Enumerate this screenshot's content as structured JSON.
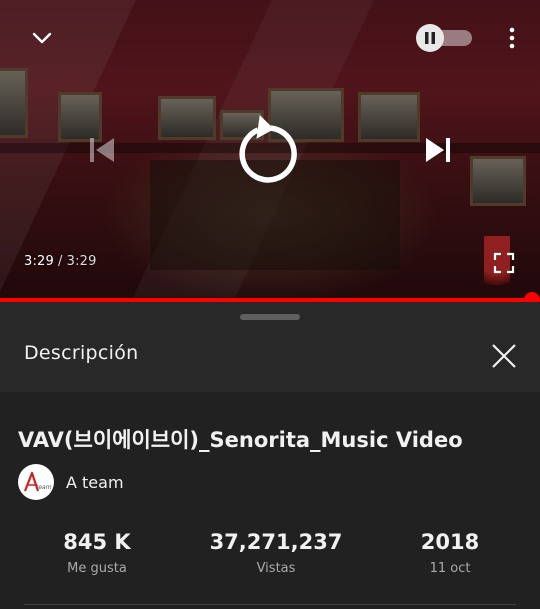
{
  "player": {
    "current_time": "3:29",
    "separator": "/",
    "duration": "3:29",
    "progress": 1.0,
    "icons": {
      "collapse": "chevron-down-icon",
      "autoplay": "pause-icon",
      "more": "more-vert-icon",
      "previous": "skip-previous-icon",
      "replay": "replay-icon",
      "next": "skip-next-icon",
      "fullscreen": "fullscreen-icon"
    },
    "colors": {
      "progress": "#ff0000"
    }
  },
  "description_panel": {
    "title": "Descripción",
    "close_icon": "close-icon",
    "video_title": "VAV(브이에이브이)_Senorita_Music Video",
    "channel": {
      "name": "A team",
      "avatar_text": "A team"
    },
    "stats": [
      {
        "value": "845 K",
        "label": "Me gusta"
      },
      {
        "value": "37,271,237",
        "label": "Vistas"
      },
      {
        "value": "2018",
        "label": "11 oct"
      }
    ]
  }
}
